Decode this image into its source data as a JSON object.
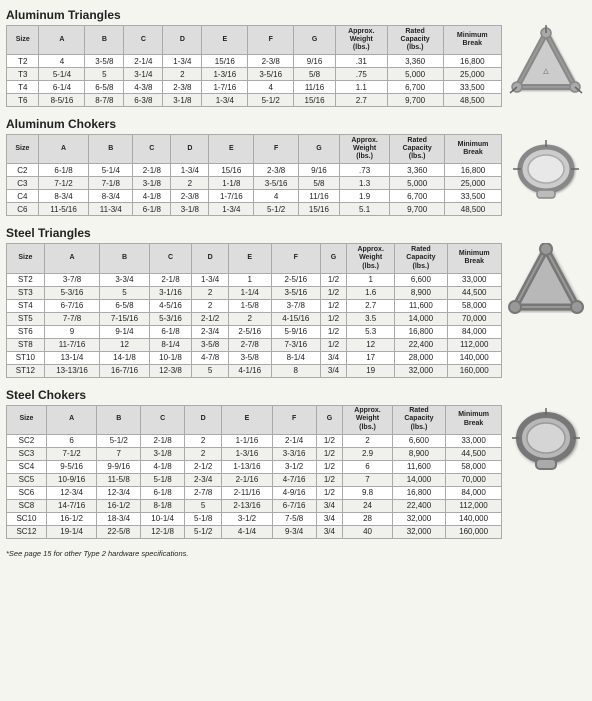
{
  "sections": [
    {
      "id": "aluminum-triangles",
      "title": "Aluminum Triangles",
      "headers": [
        "Size",
        "A",
        "B",
        "C",
        "D",
        "E",
        "F",
        "G",
        "Approx. Weight (lbs.)",
        "Rated Capacity (lbs.)",
        "Minimum Break"
      ],
      "rows": [
        [
          "T2",
          "4",
          "3-5/8",
          "2-1/4",
          "1-3/4",
          "15/16",
          "2-3/8",
          "9/16",
          ".31",
          "3,360",
          "16,800"
        ],
        [
          "T3",
          "5-1/4",
          "5",
          "3-1/4",
          "2",
          "1-3/16",
          "3-5/16",
          "5/8",
          ".75",
          "5,000",
          "25,000"
        ],
        [
          "T4",
          "6-1/4",
          "6-5/8",
          "4-3/8",
          "2-3/8",
          "1-7/16",
          "4",
          "11/16",
          "1.1",
          "6,700",
          "33,500"
        ],
        [
          "T6",
          "8-5/16",
          "8-7/8",
          "6-3/8",
          "3-1/8",
          "1-3/4",
          "5-1/2",
          "15/16",
          "2.7",
          "9,700",
          "48,500"
        ]
      ],
      "shape": "triangle"
    },
    {
      "id": "aluminum-chokers",
      "title": "Aluminum Chokers",
      "headers": [
        "Size",
        "A",
        "B",
        "C",
        "D",
        "E",
        "F",
        "G",
        "Approx. Weight (lbs.)",
        "Rated Capacity (lbs.)",
        "Minimum Break"
      ],
      "rows": [
        [
          "C2",
          "6-1/8",
          "5-1/4",
          "2-1/8",
          "1-3/4",
          "15/16",
          "2-3/8",
          "9/16",
          ".73",
          "3,360",
          "16,800"
        ],
        [
          "C3",
          "7-1/2",
          "7-1/8",
          "3-1/8",
          "2",
          "1-1/8",
          "3-5/16",
          "5/8",
          "1.3",
          "5,000",
          "25,000"
        ],
        [
          "C4",
          "8-3/4",
          "8-3/4",
          "4-1/8",
          "2-3/8",
          "1-7/16",
          "4",
          "11/16",
          "1.9",
          "6,700",
          "33,500"
        ],
        [
          "C6",
          "11-5/16",
          "11-3/4",
          "6-1/8",
          "3-1/8",
          "1-3/4",
          "5-1/2",
          "15/16",
          "5.1",
          "9,700",
          "48,500"
        ]
      ],
      "shape": "choker"
    },
    {
      "id": "steel-triangles",
      "title": "Steel Triangles",
      "headers": [
        "Size",
        "A",
        "B",
        "C",
        "D",
        "E",
        "F",
        "G",
        "Approx. Weight (lbs.)",
        "Rated Capacity (lbs.)",
        "Minimum Break"
      ],
      "rows": [
        [
          "ST2",
          "3-7/8",
          "3-3/4",
          "2-1/8",
          "1-3/4",
          "1",
          "2-5/16",
          "1/2",
          "1",
          "6,600",
          "33,000"
        ],
        [
          "ST3",
          "5-3/16",
          "5",
          "3-1/16",
          "2",
          "1-1/4",
          "3-5/16",
          "1/2",
          "1.6",
          "8,900",
          "44,500"
        ],
        [
          "ST4",
          "6-7/16",
          "6-5/8",
          "4-5/16",
          "2",
          "1-5/8",
          "3-7/8",
          "1/2",
          "2.7",
          "11,600",
          "58,000"
        ],
        [
          "ST5",
          "7-7/8",
          "7-15/16",
          "5-3/16",
          "2-1/2",
          "2",
          "4-15/16",
          "1/2",
          "3.5",
          "14,000",
          "70,000"
        ],
        [
          "ST6",
          "9",
          "9-1/4",
          "6-1/8",
          "2-3/4",
          "2-5/16",
          "5-9/16",
          "1/2",
          "5.3",
          "16,800",
          "84,000"
        ],
        [
          "ST8",
          "11-7/16",
          "12",
          "8-1/4",
          "3-5/8",
          "2-7/8",
          "7-3/16",
          "1/2",
          "12",
          "22,400",
          "112,000"
        ],
        [
          "ST10",
          "13-1/4",
          "14-1/8",
          "10-1/8",
          "4-7/8",
          "3-5/8",
          "8-1/4",
          "3/4",
          "17",
          "28,000",
          "140,000"
        ],
        [
          "ST12",
          "13-13/16",
          "16-7/16",
          "12-3/8",
          "5",
          "4-1/16",
          "8",
          "3/4",
          "19",
          "32,000",
          "160,000"
        ]
      ],
      "shape": "steel-triangle"
    },
    {
      "id": "steel-chokers",
      "title": "Steel Chokers",
      "headers": [
        "Size",
        "A",
        "B",
        "C",
        "D",
        "E",
        "F",
        "G",
        "Approx. Weight (lbs.)",
        "Rated Capacity (lbs.)",
        "Minimum Break"
      ],
      "rows": [
        [
          "SC2",
          "6",
          "5-1/2",
          "2-1/8",
          "2",
          "1-1/16",
          "2-1/4",
          "1/2",
          "2",
          "6,600",
          "33,000"
        ],
        [
          "SC3",
          "7-1/2",
          "7",
          "3-1/8",
          "2",
          "1-3/16",
          "3-3/16",
          "1/2",
          "2.9",
          "8,900",
          "44,500"
        ],
        [
          "SC4",
          "9-5/16",
          "9-9/16",
          "4-1/8",
          "2-1/2",
          "1-13/16",
          "3-1/2",
          "1/2",
          "6",
          "11,600",
          "58,000"
        ],
        [
          "SC5",
          "10-9/16",
          "11-5/8",
          "5-1/8",
          "2-3/4",
          "2-1/16",
          "4-7/16",
          "1/2",
          "7",
          "14,000",
          "70,000"
        ],
        [
          "SC6",
          "12-3/4",
          "12-3/4",
          "6-1/8",
          "2-7/8",
          "2-11/16",
          "4-9/16",
          "1/2",
          "9.8",
          "16,800",
          "84,000"
        ],
        [
          "SC8",
          "14-7/16",
          "16-1/2",
          "8-1/8",
          "5",
          "2-13/16",
          "6-7/16",
          "3/4",
          "24",
          "22,400",
          "112,000"
        ],
        [
          "SC10",
          "16-1/2",
          "18-3/4",
          "10-1/4",
          "5-1/8",
          "3-1/2",
          "7-5/8",
          "3/4",
          "28",
          "32,000",
          "140,000"
        ],
        [
          "SC12",
          "19-1/4",
          "22-5/8",
          "12-1/8",
          "5-1/2",
          "4-1/4",
          "9-3/4",
          "3/4",
          "40",
          "32,000",
          "160,000"
        ]
      ],
      "shape": "steel-choker"
    }
  ],
  "footnote": "*See page 15 for other Type 2 hardware specifications."
}
